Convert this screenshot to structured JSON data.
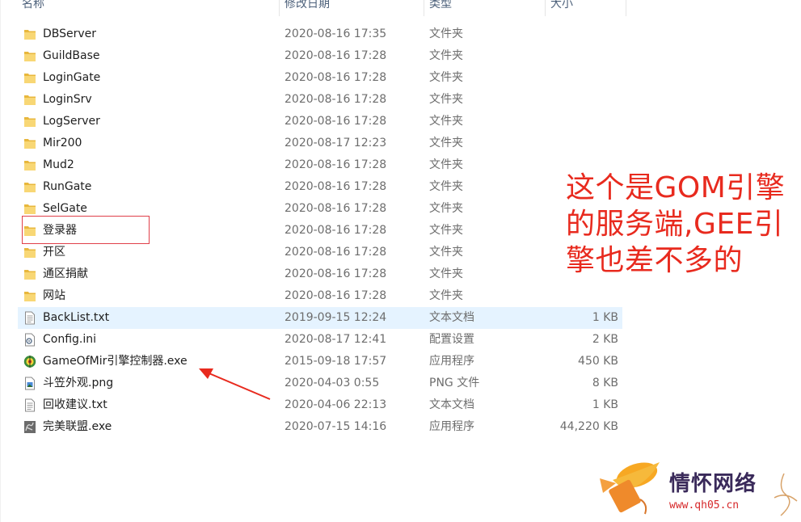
{
  "columns": {
    "name": "名称",
    "date": "修改日期",
    "type": "类型",
    "size": "大小"
  },
  "files": [
    {
      "name": "DBServer",
      "date": "2020-08-16 17:35",
      "type": "文件夹",
      "size": "",
      "icon": "folder-icon"
    },
    {
      "name": "GuildBase",
      "date": "2020-08-16 17:28",
      "type": "文件夹",
      "size": "",
      "icon": "folder-icon"
    },
    {
      "name": "LoginGate",
      "date": "2020-08-16 17:28",
      "type": "文件夹",
      "size": "",
      "icon": "folder-icon"
    },
    {
      "name": "LoginSrv",
      "date": "2020-08-16 17:28",
      "type": "文件夹",
      "size": "",
      "icon": "folder-icon"
    },
    {
      "name": "LogServer",
      "date": "2020-08-16 17:28",
      "type": "文件夹",
      "size": "",
      "icon": "folder-icon"
    },
    {
      "name": "Mir200",
      "date": "2020-08-17 12:23",
      "type": "文件夹",
      "size": "",
      "icon": "folder-icon"
    },
    {
      "name": "Mud2",
      "date": "2020-08-16 17:28",
      "type": "文件夹",
      "size": "",
      "icon": "folder-icon"
    },
    {
      "name": "RunGate",
      "date": "2020-08-16 17:28",
      "type": "文件夹",
      "size": "",
      "icon": "folder-icon"
    },
    {
      "name": "SelGate",
      "date": "2020-08-16 17:28",
      "type": "文件夹",
      "size": "",
      "icon": "folder-icon"
    },
    {
      "name": "登录器",
      "date": "2020-08-16 17:28",
      "type": "文件夹",
      "size": "",
      "icon": "folder-icon"
    },
    {
      "name": "开区",
      "date": "2020-08-16 17:28",
      "type": "文件夹",
      "size": "",
      "icon": "folder-icon"
    },
    {
      "name": "通区捐献",
      "date": "2020-08-16 17:28",
      "type": "文件夹",
      "size": "",
      "icon": "folder-icon"
    },
    {
      "name": "网站",
      "date": "2020-08-16 17:28",
      "type": "文件夹",
      "size": "",
      "icon": "folder-icon"
    },
    {
      "name": "BackList.txt",
      "date": "2019-09-15 12:24",
      "type": "文本文档",
      "size": "1 KB",
      "icon": "text-file-icon",
      "selected": true
    },
    {
      "name": "Config.ini",
      "date": "2020-08-17 12:41",
      "type": "配置设置",
      "size": "2 KB",
      "icon": "settings-file-icon"
    },
    {
      "name": "GameOfMir引擎控制器.exe",
      "date": "2015-09-18 17:57",
      "type": "应用程序",
      "size": "450 KB",
      "icon": "app-exe-icon"
    },
    {
      "name": "斗笠外观.png",
      "date": "2020-04-03 0:55",
      "type": "PNG 文件",
      "size": "8 KB",
      "icon": "image-file-icon"
    },
    {
      "name": "回收建议.txt",
      "date": "2020-04-06 22:13",
      "type": "文本文档",
      "size": "1 KB",
      "icon": "text-file-icon"
    },
    {
      "name": "完美联盟.exe",
      "date": "2020-07-15 14:16",
      "type": "应用程序",
      "size": "44,220 KB",
      "icon": "dragon-exe-icon"
    }
  ],
  "annotation": {
    "line1": "这个是GOM引擎",
    "line2": "的服务端,GEE引",
    "line3": "擎也差不多的"
  },
  "logo": {
    "text": "情怀网络",
    "url": "www.qh05.cn"
  },
  "colors": {
    "annotation": "#e82a1e",
    "highlight_box": "#e0404a",
    "selected_row": "#e5f3ff",
    "folder": "#f8c94a"
  }
}
